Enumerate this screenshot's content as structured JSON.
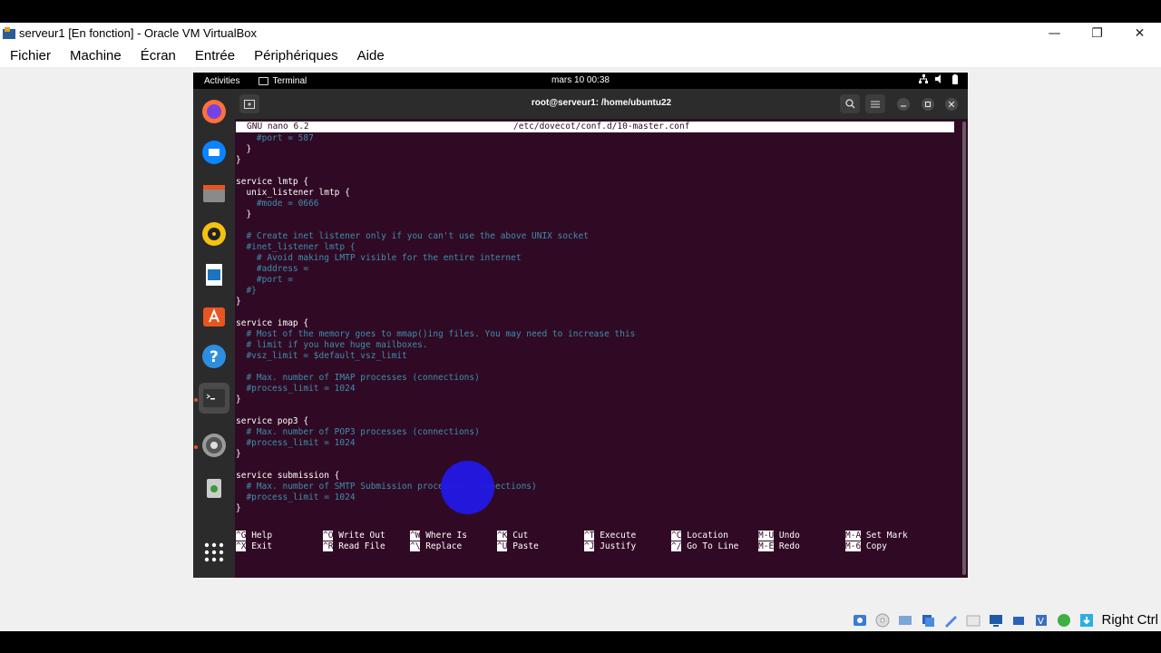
{
  "window": {
    "title": "serveur1 [En fonction] - Oracle VM VirtualBox",
    "controls": {
      "minimize": "—",
      "restore": "❐",
      "close": "✕"
    }
  },
  "menu": [
    "Fichier",
    "Machine",
    "Écran",
    "Entrée",
    "Périphériques",
    "Aide"
  ],
  "statusbar": {
    "host_key": "Right Ctrl"
  },
  "guest": {
    "topbar": {
      "activities": "Activities",
      "app_name": "Terminal",
      "clock": "mars 10  00:38"
    },
    "dock": [
      {
        "name": "firefox-icon",
        "color": "#ff7139"
      },
      {
        "name": "thunderbird-icon",
        "color": "#0a84ff"
      },
      {
        "name": "files-icon",
        "color": "#8a8a8a"
      },
      {
        "name": "rhythmbox-icon",
        "color": "#f5c211"
      },
      {
        "name": "writer-icon",
        "color": "#1e73be"
      },
      {
        "name": "software-icon",
        "color": "#e95420"
      },
      {
        "name": "help-icon",
        "color": "#2d8ee0"
      },
      {
        "name": "terminal-icon",
        "color": "#333333"
      },
      {
        "name": "settings-icon",
        "color": "#9a9a9a"
      },
      {
        "name": "trash-icon",
        "color": "#6a8f6a"
      }
    ],
    "terminal": {
      "title": "root@serveur1: /home/ubuntu22",
      "nano_version": "GNU nano 6.2",
      "nano_file": "/etc/dovecot/conf.d/10-master.conf",
      "lines": [
        {
          "text": "    #port = 587",
          "comment": true
        },
        {
          "text": "  }",
          "comment": false
        },
        {
          "text": "}",
          "comment": false
        },
        {
          "text": "",
          "comment": false
        },
        {
          "text": "service lmtp {",
          "comment": false
        },
        {
          "text": "  unix_listener lmtp {",
          "comment": false
        },
        {
          "text": "    #mode = 0666",
          "comment": true
        },
        {
          "text": "  }",
          "comment": false
        },
        {
          "text": "",
          "comment": false
        },
        {
          "text": "  # Create inet listener only if you can't use the above UNIX socket",
          "comment": true
        },
        {
          "text": "  #inet_listener lmtp {",
          "comment": true
        },
        {
          "text": "    # Avoid making LMTP visible for the entire internet",
          "comment": true
        },
        {
          "text": "    #address =",
          "comment": true
        },
        {
          "text": "    #port =",
          "comment": true
        },
        {
          "text": "  #}",
          "comment": true
        },
        {
          "text": "}",
          "comment": false
        },
        {
          "text": "",
          "comment": false
        },
        {
          "text": "service imap {",
          "comment": false
        },
        {
          "text": "  # Most of the memory goes to mmap()ing files. You may need to increase this",
          "comment": true
        },
        {
          "text": "  # limit if you have huge mailboxes.",
          "comment": true
        },
        {
          "text": "  #vsz_limit = $default_vsz_limit",
          "comment": true
        },
        {
          "text": "",
          "comment": false
        },
        {
          "text": "  # Max. number of IMAP processes (connections)",
          "comment": true
        },
        {
          "text": "  #process_limit = 1024",
          "comment": true
        },
        {
          "text": "}",
          "comment": false
        },
        {
          "text": "",
          "comment": false
        },
        {
          "text": "service pop3 {",
          "comment": false
        },
        {
          "text": "  # Max. number of POP3 processes (connections)",
          "comment": true
        },
        {
          "text": "  #process_limit = 1024",
          "comment": true
        },
        {
          "text": "}",
          "comment": false
        },
        {
          "text": "",
          "comment": false
        },
        {
          "text": "service submission {",
          "comment": false
        },
        {
          "text": "  # Max. number of SMTP Submission processes (connections)",
          "comment": true
        },
        {
          "text": "  #process_limit = 1024",
          "comment": true
        },
        {
          "text": "}",
          "comment": false
        }
      ],
      "shortcuts": [
        {
          "key": "^G",
          "label": "Help"
        },
        {
          "key": "^O",
          "label": "Write Out"
        },
        {
          "key": "^W",
          "label": "Where Is"
        },
        {
          "key": "^K",
          "label": "Cut"
        },
        {
          "key": "^T",
          "label": "Execute"
        },
        {
          "key": "^C",
          "label": "Location"
        },
        {
          "key": "M-U",
          "label": "Undo"
        },
        {
          "key": "M-A",
          "label": "Set Mark"
        },
        {
          "key": "^X",
          "label": "Exit"
        },
        {
          "key": "^R",
          "label": "Read File"
        },
        {
          "key": "^\\",
          "label": "Replace"
        },
        {
          "key": "^U",
          "label": "Paste"
        },
        {
          "key": "^J",
          "label": "Justify"
        },
        {
          "key": "^/",
          "label": "Go To Line"
        },
        {
          "key": "M-E",
          "label": "Redo"
        },
        {
          "key": "M-6",
          "label": "Copy"
        }
      ]
    }
  }
}
